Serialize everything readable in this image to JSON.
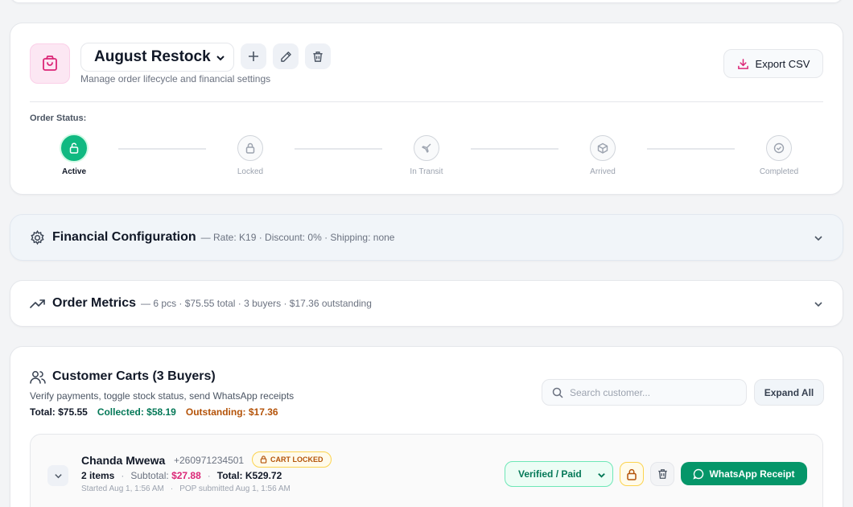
{
  "colors": {
    "accent_pink": "#db2777",
    "success_green": "#10b981",
    "collected_green": "#047857",
    "outstanding_amber": "#b45309",
    "whatsapp_green": "#059669"
  },
  "order": {
    "icon": "shopping-bag-icon",
    "selected_order": "August Restock",
    "subtitle": "Manage order lifecycle and financial settings",
    "export_label": "Export CSV",
    "status_label": "Order Status:",
    "steps": [
      {
        "label": "Active",
        "icon": "unlock-icon",
        "active": true
      },
      {
        "label": "Locked",
        "icon": "lock-icon",
        "active": false
      },
      {
        "label": "In Transit",
        "icon": "plane-icon",
        "active": false
      },
      {
        "label": "Arrived",
        "icon": "package-icon",
        "active": false
      },
      {
        "label": "Completed",
        "icon": "check-circle-icon",
        "active": false
      }
    ]
  },
  "financial": {
    "title": "Financial Configuration",
    "summary": "— Rate: K19 · Discount: 0% · Shipping: none"
  },
  "metrics": {
    "title": "Order Metrics",
    "summary": "— 6 pcs · $75.55 total · 3 buyers · $17.36 outstanding"
  },
  "carts": {
    "title": "Customer Carts (3 Buyers)",
    "subtitle": "Verify payments, toggle stock status, send WhatsApp receipts",
    "total": "Total: $75.55",
    "collected": "Collected: $58.19",
    "outstanding": "Outstanding: $17.36",
    "search_placeholder": "Search customer...",
    "expand_label": "Expand All",
    "rows": [
      {
        "name": "Chanda Mwewa",
        "phone": "+260971234501",
        "badge": "CART LOCKED",
        "items": "2 items",
        "subtotal_label": "Subtotal:",
        "subtotal_value": "$27.88",
        "total": "Total: K529.72",
        "started": "Started Aug 1, 1:56 AM",
        "pop": "POP submitted Aug 1, 1:56 AM",
        "payment_status": "Verified / Paid",
        "whatsapp_label": "WhatsApp Receipt"
      }
    ]
  }
}
